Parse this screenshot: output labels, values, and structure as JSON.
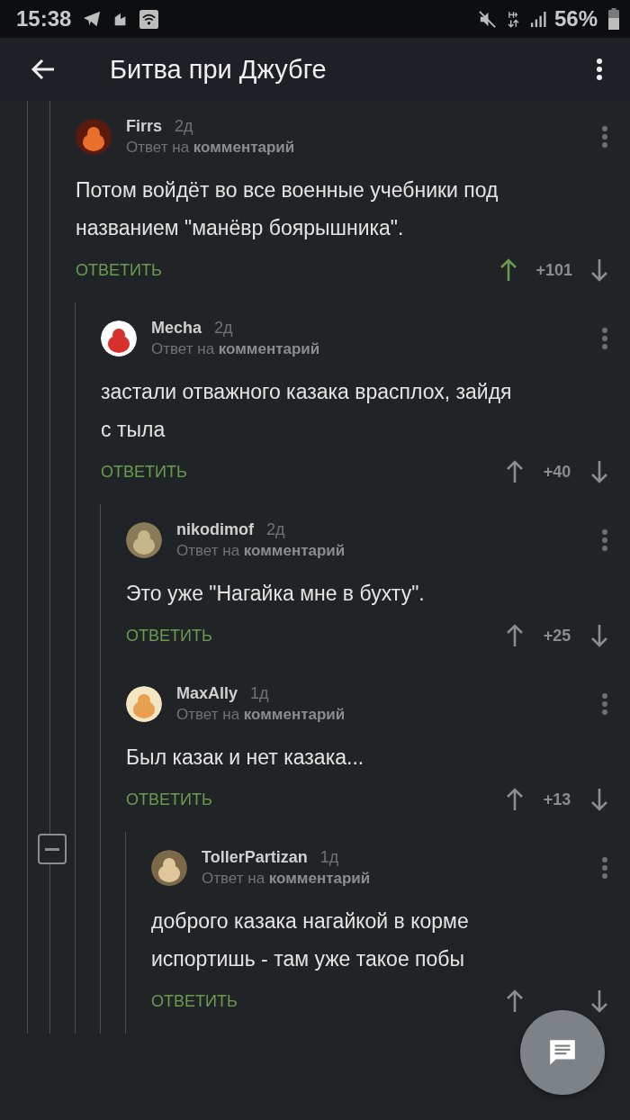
{
  "status_bar": {
    "time": "15:38",
    "battery": "56%"
  },
  "app_bar": {
    "title": "Битва при Джубге"
  },
  "comments": [
    {
      "author": "Firrs",
      "age": "2д",
      "reply_prefix": "Ответ на",
      "reply_target": "комментарий",
      "lines": [
        "Потом войдёт во все военные учебники под",
        "названием \"манёвр боярышника\"."
      ],
      "reply_label": "ОТВЕТИТЬ",
      "score": "+101",
      "upvoted": true,
      "children": [
        {
          "author": "Mecha",
          "age": "2д",
          "reply_prefix": "Ответ на",
          "reply_target": "комментарий",
          "lines": [
            "застали отважного казака врасплох, зайдя",
            "с тыла"
          ],
          "reply_label": "ОТВЕТИТЬ",
          "score": "+40",
          "upvoted": false,
          "children": [
            {
              "author": "nikodimof",
              "age": "2д",
              "reply_prefix": "Ответ на",
              "reply_target": "комментарий",
              "lines": [
                "Это уже \"Нагайка мне в бухту\"."
              ],
              "reply_label": "ОТВЕТИТЬ",
              "score": "+25",
              "upvoted": false
            },
            {
              "author": "MaxAlly",
              "age": "1д",
              "reply_prefix": "Ответ на",
              "reply_target": "комментарий",
              "lines": [
                "Был казак и нет казака..."
              ],
              "reply_label": "ОТВЕТИТЬ",
              "score": "+13",
              "upvoted": false,
              "children": [
                {
                  "author": "TollerPartizan",
                  "age": "1д",
                  "reply_prefix": "Ответ на",
                  "reply_target": "комментарий",
                  "lines": [
                    "доброго казака нагайкой в корме",
                    "испортишь - там уже такое побы"
                  ],
                  "reply_label": "ОТВЕТИТЬ",
                  "upvoted": false
                }
              ]
            }
          ]
        }
      ]
    }
  ]
}
